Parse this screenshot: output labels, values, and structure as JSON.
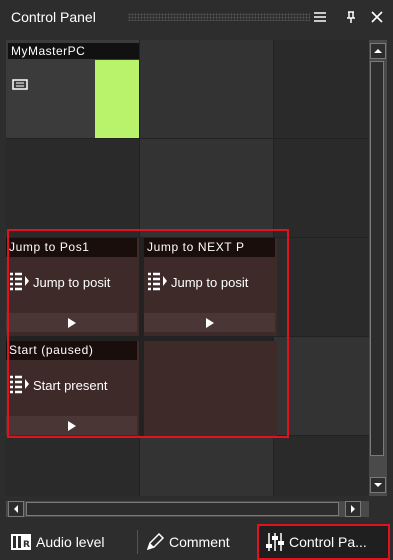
{
  "panel": {
    "title": "Control Panel"
  },
  "master": {
    "name": "MyMasterPC",
    "status_color": "#b9f26b"
  },
  "actions": [
    {
      "title": "Jump to Pos1",
      "description": "Jump to posit"
    },
    {
      "title": "Jump to NEXT P",
      "description": "Jump to posit"
    },
    {
      "title": "Start  (paused)",
      "description": "Start present"
    }
  ],
  "tabs": [
    {
      "label": "Audio level",
      "icon": "audio-level-icon"
    },
    {
      "label": "Comment",
      "icon": "pen-icon"
    },
    {
      "label": "Control Pa...",
      "icon": "mixer-icon",
      "active": true
    }
  ],
  "colors": {
    "highlight": "#e0121f",
    "tile_active": "#3e2a28"
  }
}
